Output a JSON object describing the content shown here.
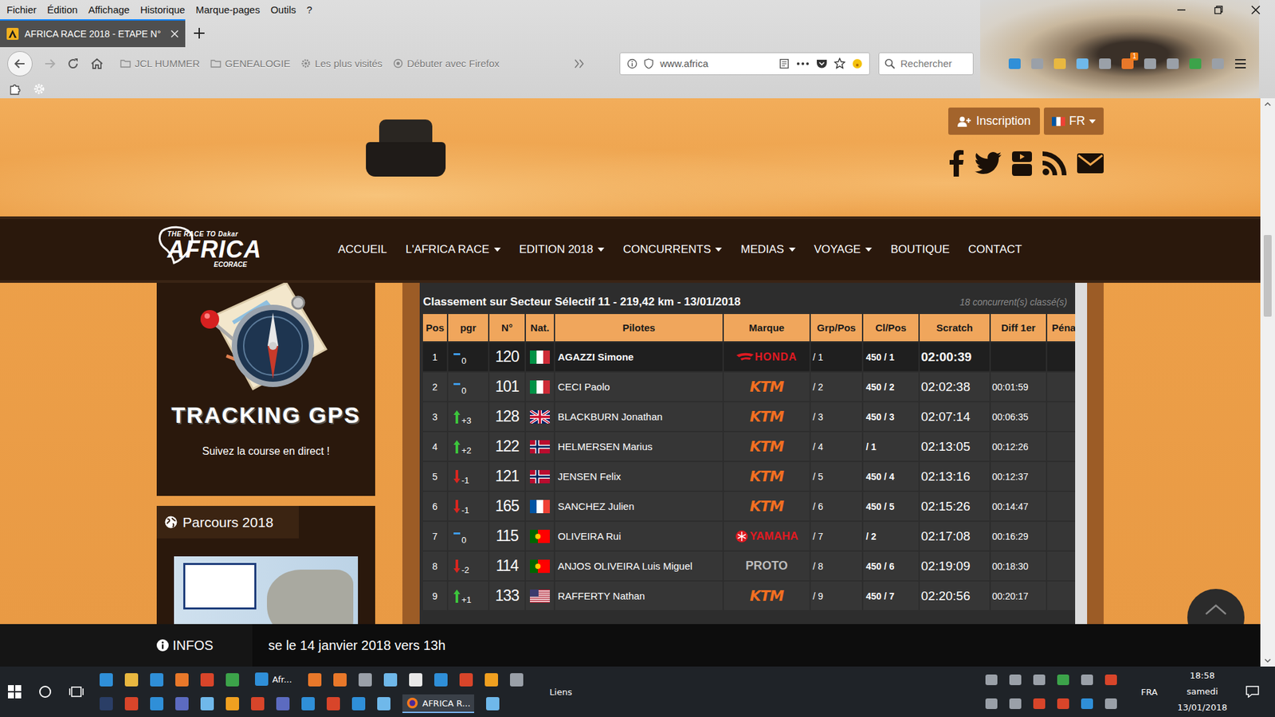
{
  "browser": {
    "menu": [
      "Fichier",
      "Édition",
      "Affichage",
      "Historique",
      "Marque-pages",
      "Outils",
      "?"
    ],
    "tab": {
      "label": "AFRICA RACE 2018 - ETAPE N°",
      "selected": true
    },
    "bookmarks": [
      "JCL HUMMER",
      "GENEALOGIE",
      "Les plus visités",
      "Débuter avec Firefox"
    ],
    "url": "www.africa",
    "search_placeholder": "Rechercher",
    "extension_badge": "1",
    "page_scroll": {
      "level": 0.27
    }
  },
  "site": {
    "logo": {
      "tagline": "THE RACE TO Dakar",
      "name": "AFRICA",
      "sub": "ECORACE"
    },
    "inscription": "Inscription",
    "language": "FR",
    "nav": [
      {
        "label": "ACCUEIL",
        "dropdown": false
      },
      {
        "label": "L'AFRICA RACE",
        "dropdown": true
      },
      {
        "label": "EDITION 2018",
        "dropdown": true
      },
      {
        "label": "CONCURRENTS",
        "dropdown": true
      },
      {
        "label": "MEDIAS",
        "dropdown": true
      },
      {
        "label": "VOYAGE",
        "dropdown": true
      },
      {
        "label": "BOUTIQUE",
        "dropdown": false
      },
      {
        "label": "CONTACT",
        "dropdown": false
      }
    ],
    "sidebar": {
      "tracking": {
        "title": "TRACKING GPS",
        "caption": "Suivez la course en direct !"
      },
      "parcours": {
        "title": "Parcours 2018"
      }
    },
    "table": {
      "title": "Classement sur Secteur Sélectif 11 - 219,42 km - 13/01/2018",
      "count": "18 concurrent(s) classé(s)",
      "columns": [
        "Pos",
        "pgr",
        "N°",
        "Nat.",
        "Pilotes",
        "Marque",
        "Grp/Pos",
        "Cl/Pos",
        "Scratch",
        "Diff 1er",
        "Péna"
      ],
      "rows": [
        {
          "pos": "1",
          "trend": "same",
          "pgr": "0",
          "num": "120",
          "nat": "it",
          "pilot": "AGAZZI Simone",
          "brand": "HONDA",
          "brand_kind": "honda",
          "grp": "/ 1",
          "cl": "450 / 1",
          "scratch": "02:00:39",
          "diff": "",
          "pena": "",
          "leader": true
        },
        {
          "pos": "2",
          "trend": "same",
          "pgr": "0",
          "num": "101",
          "nat": "it",
          "pilot": "CECI Paolo",
          "brand": "KTM",
          "brand_kind": "ktm",
          "grp": "/ 2",
          "cl": "450 / 2",
          "scratch": "02:02:38",
          "diff": "00:01:59",
          "pena": "",
          "leader": false
        },
        {
          "pos": "3",
          "trend": "up",
          "pgr": "+3",
          "num": "128",
          "nat": "gb",
          "pilot": "BLACKBURN Jonathan",
          "brand": "KTM",
          "brand_kind": "ktm",
          "grp": "/ 3",
          "cl": "450 / 3",
          "scratch": "02:07:14",
          "diff": "00:06:35",
          "pena": "",
          "leader": false
        },
        {
          "pos": "4",
          "trend": "up",
          "pgr": "+2",
          "num": "122",
          "nat": "no",
          "pilot": "HELMERSEN Marius",
          "brand": "KTM",
          "brand_kind": "ktm",
          "grp": "/ 4",
          "cl": "/ 1",
          "scratch": "02:13:05",
          "diff": "00:12:26",
          "pena": "",
          "leader": false
        },
        {
          "pos": "5",
          "trend": "down",
          "pgr": "-1",
          "num": "121",
          "nat": "no",
          "pilot": "JENSEN Felix",
          "brand": "KTM",
          "brand_kind": "ktm",
          "grp": "/ 5",
          "cl": "450 / 4",
          "scratch": "02:13:16",
          "diff": "00:12:37",
          "pena": "",
          "leader": false
        },
        {
          "pos": "6",
          "trend": "down",
          "pgr": "-1",
          "num": "165",
          "nat": "fr",
          "pilot": "SANCHEZ Julien",
          "brand": "KTM",
          "brand_kind": "ktm",
          "grp": "/ 6",
          "cl": "450 / 5",
          "scratch": "02:15:26",
          "diff": "00:14:47",
          "pena": "",
          "leader": false
        },
        {
          "pos": "7",
          "trend": "same",
          "pgr": "0",
          "num": "115",
          "nat": "pt",
          "pilot": "OLIVEIRA Rui",
          "brand": "YAMAHA",
          "brand_kind": "yamaha",
          "grp": "/ 7",
          "cl": "/ 2",
          "scratch": "02:17:08",
          "diff": "00:16:29",
          "pena": "",
          "leader": false
        },
        {
          "pos": "8",
          "trend": "down",
          "pgr": "-2",
          "num": "114",
          "nat": "pt",
          "pilot": "ANJOS OLIVEIRA Luis Miguel",
          "brand": "PROTO",
          "brand_kind": "proto",
          "grp": "/ 8",
          "cl": "450 / 6",
          "scratch": "02:19:09",
          "diff": "00:18:30",
          "pena": "",
          "leader": false
        },
        {
          "pos": "9",
          "trend": "up",
          "pgr": "+1",
          "num": "133",
          "nat": "us",
          "pilot": "RAFFERTY Nathan",
          "brand": "KTM",
          "brand_kind": "ktm",
          "grp": "/ 9",
          "cl": "450 / 7",
          "scratch": "02:20:56",
          "diff": "00:20:17",
          "pena": "",
          "leader": false
        }
      ]
    },
    "info": {
      "label": "INFOS",
      "text": "se le 14 janvier 2018 vers 13h"
    }
  },
  "taskbar": {
    "pinned_task": "Afr...",
    "links": "Liens",
    "active_task": {
      "label": "AFRICA R...",
      "selected": true
    },
    "language": "FRA",
    "time": "18:58",
    "day": "samedi",
    "date": "13/01/2018"
  }
}
